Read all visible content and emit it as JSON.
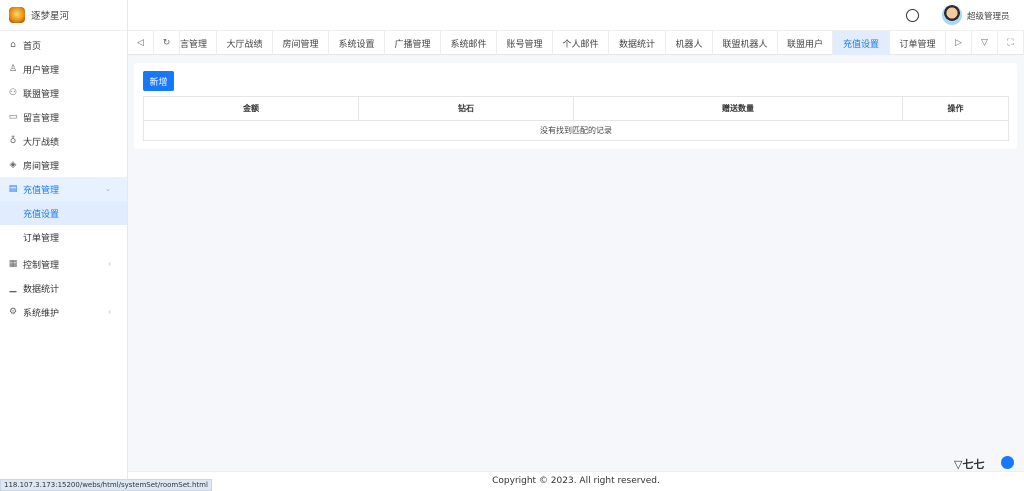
{
  "app": {
    "title": "逐梦星河"
  },
  "sidebar": {
    "items": [
      {
        "label": "首页",
        "icon": "home-icon"
      },
      {
        "label": "用户管理",
        "icon": "user-icon"
      },
      {
        "label": "联盟管理",
        "icon": "group-icon"
      },
      {
        "label": "留言管理",
        "icon": "message-icon"
      },
      {
        "label": "大厅战绩",
        "icon": "trophy-icon"
      },
      {
        "label": "房间管理",
        "icon": "room-icon"
      },
      {
        "label": "充值管理",
        "icon": "recharge-icon",
        "children": [
          {
            "label": "充值设置"
          },
          {
            "label": "订单管理"
          }
        ]
      },
      {
        "label": "控制管理",
        "icon": "control-icon"
      },
      {
        "label": "数据统计",
        "icon": "chart-icon"
      },
      {
        "label": "系统维护",
        "icon": "gear-icon"
      }
    ]
  },
  "header": {
    "username": "超级管理员"
  },
  "tabs": [
    "言管理",
    "大厅战绩",
    "房间管理",
    "系统设置",
    "广播管理",
    "系统邮件",
    "账号管理",
    "个人邮件",
    "数据统计",
    "机器人",
    "联盟机器人",
    "联盟用户",
    "充值设置",
    "订单管理"
  ],
  "active_tab": "充值设置",
  "main": {
    "add_label": "新增",
    "columns": [
      "金额",
      "钻石",
      "赠送数量",
      "操作"
    ],
    "empty_text": "没有找到匹配的记录"
  },
  "footer": {
    "copyright": "Copyright © 2023. All right reserved."
  },
  "status_url": "118.107.3.173:15200/webs/html/systemSet/roomSet.html",
  "watermark": "七七源码",
  "colors": {
    "accent": "#1677ff",
    "active_bg": "#e1edff"
  }
}
